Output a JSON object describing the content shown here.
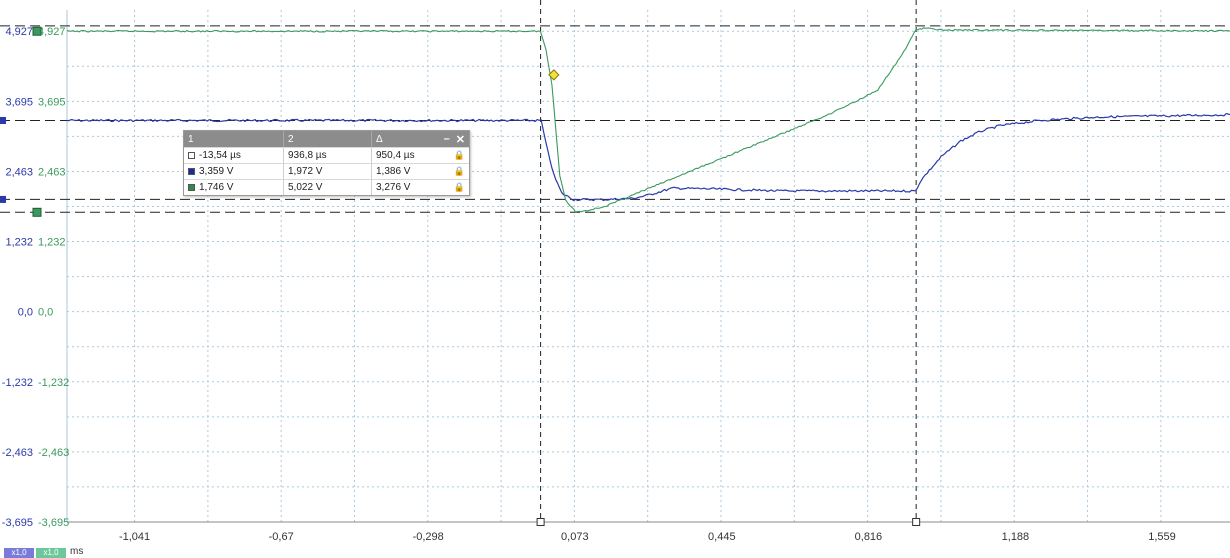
{
  "chart_data": {
    "type": "line",
    "x_unit": "ms",
    "x_ticks": [
      "-1,041",
      "-0,67",
      "-0,298",
      "0,073",
      "0,445",
      "0,816",
      "1,188",
      "1,559"
    ],
    "x_tick_values": [
      -1.041,
      -0.67,
      -0.298,
      0.073,
      0.445,
      0.816,
      1.188,
      1.559
    ],
    "xlim": [
      -1.212,
      1.731
    ],
    "y_ticks": [
      "4,927",
      "3,695",
      "2,463",
      "1,232",
      "0,0",
      "-1,232",
      "-2,463",
      "-3,695"
    ],
    "y_tick_values": [
      4.927,
      3.695,
      2.463,
      1.232,
      0.0,
      -1.232,
      -2.463,
      -3.695
    ],
    "ylim": [
      -3.695,
      5.3
    ],
    "grid": true,
    "series": [
      {
        "color": "#2a3aa8",
        "scale": "x1,0",
        "points": [
          [
            -1.212,
            3.359
          ],
          [
            -0.012,
            3.359
          ],
          [
            0.0,
            2.95
          ],
          [
            0.02,
            2.4
          ],
          [
            0.04,
            2.08
          ],
          [
            0.07,
            1.97
          ],
          [
            0.15,
            1.97
          ],
          [
            0.22,
            1.99
          ],
          [
            0.26,
            2.05
          ],
          [
            0.32,
            2.17
          ],
          [
            0.4,
            2.16
          ],
          [
            0.6,
            2.12
          ],
          [
            0.9,
            2.12
          ],
          [
            0.935,
            2.12
          ],
          [
            0.95,
            2.32
          ],
          [
            1.0,
            2.72
          ],
          [
            1.05,
            3.0
          ],
          [
            1.1,
            3.17
          ],
          [
            1.15,
            3.27
          ],
          [
            1.25,
            3.36
          ],
          [
            1.4,
            3.42
          ],
          [
            1.731,
            3.46
          ]
        ]
      },
      {
        "color": "#3a9a5e",
        "scale": "x1,0",
        "points": [
          [
            -1.212,
            4.927
          ],
          [
            -0.014,
            4.927
          ],
          [
            0.0,
            4.6
          ],
          [
            0.015,
            4.0
          ],
          [
            0.025,
            3.2
          ],
          [
            0.035,
            2.4
          ],
          [
            0.05,
            1.95
          ],
          [
            0.075,
            1.76
          ],
          [
            0.09,
            1.76
          ],
          [
            0.15,
            1.85
          ],
          [
            0.3,
            2.28
          ],
          [
            0.5,
            2.85
          ],
          [
            0.7,
            3.42
          ],
          [
            0.78,
            3.68
          ],
          [
            0.84,
            3.9
          ],
          [
            0.9,
            4.5
          ],
          [
            0.937,
            4.96
          ],
          [
            0.96,
            4.98
          ],
          [
            1.0,
            4.95
          ],
          [
            1.731,
            4.93
          ]
        ]
      }
    ],
    "cursors_x": [
      -0.01354,
      0.9368
    ],
    "cursors_y": [
      3.359,
      1.972,
      1.746,
      5.022
    ],
    "marker_point": [
      0.02,
      4.16
    ]
  },
  "cursor_table": {
    "headers": [
      "1",
      "2",
      "Δ"
    ],
    "rows": [
      {
        "c1": "-13,54 µs",
        "c2": "936,8 µs",
        "delta": "950,4 µs",
        "swatch": "#ffffff"
      },
      {
        "c1": "3,359 V",
        "c2": "1,972 V",
        "delta": "1,386 V",
        "swatch": "#1a2aa0"
      },
      {
        "c1": "1,746 V",
        "c2": "5,022 V",
        "delta": "3,276 V",
        "swatch": "#2f8a50"
      }
    ],
    "minimize_glyph": "–",
    "close_glyph": "✕",
    "lock_glyph": "🔒"
  },
  "scale_chips": [
    {
      "label": "x1,0",
      "color": "#7a7ad8"
    },
    {
      "label": "x1,0",
      "color": "#6cc79a"
    }
  ],
  "x_unit_label": "ms",
  "colors": {
    "grid": "#a9c9df",
    "blue_axis": "#2a3aa8",
    "green_axis": "#3a9a5e",
    "cursor": "#222222",
    "marker": "#f0e040"
  }
}
